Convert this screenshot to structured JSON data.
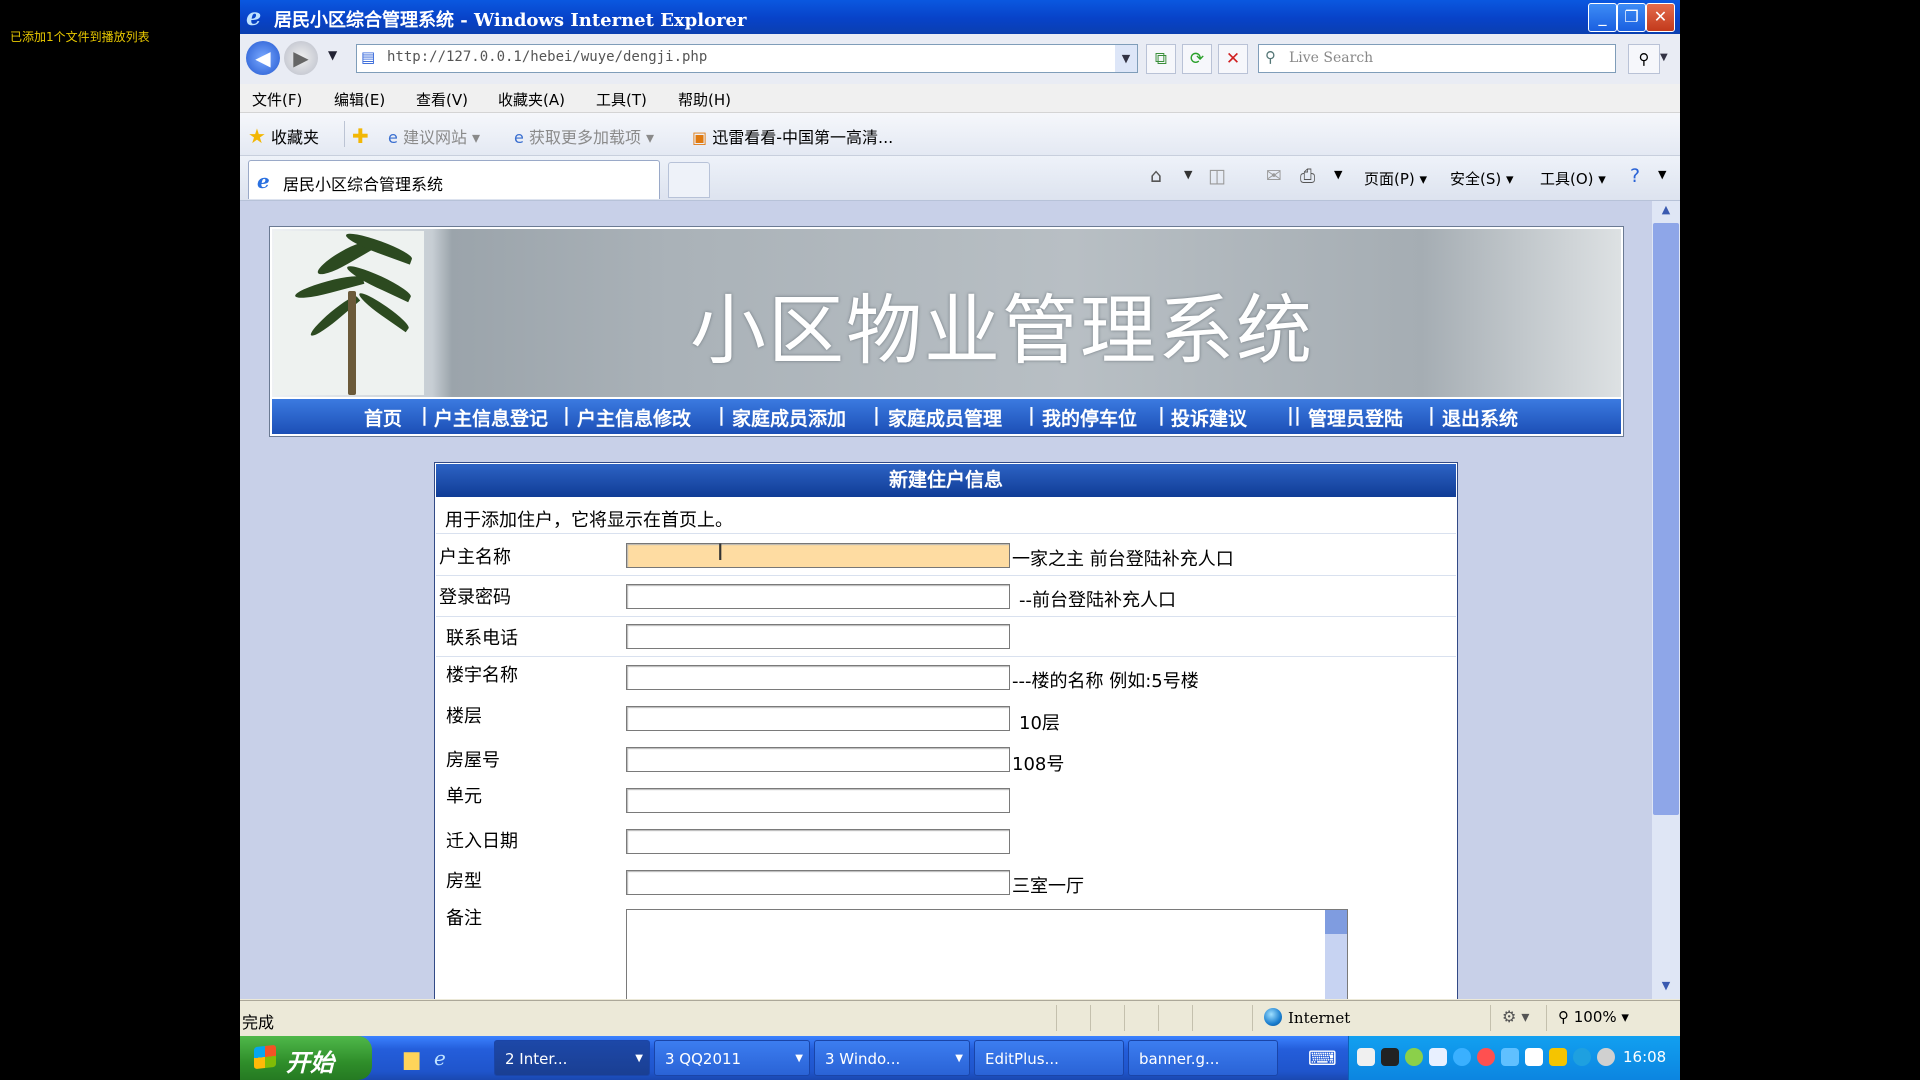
{
  "overlay_note": "已添加1个文件到播放列表",
  "window": {
    "title": "居民小区综合管理系统 - Windows Internet Explorer",
    "minimize": "_",
    "maximize": "❐",
    "close": "✕"
  },
  "address": {
    "url": "http://127.0.0.1/hebei/wuye/dengji.php",
    "search_placeholder": "Live Search"
  },
  "menu": [
    "文件(F)",
    "编辑(E)",
    "查看(V)",
    "收藏夹(A)",
    "工具(T)",
    "帮助(H)"
  ],
  "favorites": {
    "label": "收藏夹",
    "links": [
      "建议网站",
      "获取更多加载项",
      "迅雷看看-中国第一高清..."
    ]
  },
  "tab": {
    "label": "居民小区综合管理系统"
  },
  "commands": {
    "page": "页面(P)",
    "safety": "安全(S)",
    "tools": "工具(O)"
  },
  "banner": {
    "title": "小区物业管理系统"
  },
  "site_nav": [
    "首页",
    "|",
    "户主信息登记",
    "|",
    "户主信息修改",
    "|",
    "家庭成员添加",
    "|",
    "家庭成员管理",
    "|",
    "我的停车位",
    "|",
    "投诉建议",
    "||",
    "管理员登陆",
    "|",
    "退出系统"
  ],
  "form": {
    "heading": "新建住户信息",
    "description": "用于添加住户，它将显示在首页上。",
    "fields": [
      {
        "label": "户主名称",
        "value": "",
        "hint": "一家之主 前台登陆补充人口"
      },
      {
        "label": "登录密码",
        "value": "",
        "hint": "--前台登陆补充人口"
      },
      {
        "label": "联系电话",
        "value": "",
        "hint": ""
      },
      {
        "label": "楼宇名称",
        "value": "",
        "hint": "---楼的名称 例如:5号楼"
      },
      {
        "label": "楼层",
        "value": "",
        "hint": "10层"
      },
      {
        "label": "房屋号",
        "value": "",
        "hint": "108号"
      },
      {
        "label": "单元",
        "value": "",
        "hint": ""
      },
      {
        "label": "迁入日期",
        "value": "",
        "hint": ""
      },
      {
        "label": "房型",
        "value": "",
        "hint": "三室一厅"
      },
      {
        "label": "备注",
        "value": "",
        "hint": ""
      }
    ]
  },
  "status": {
    "text": "完成",
    "zone": "Internet",
    "zoom": "100%"
  },
  "taskbar": {
    "start": "开始",
    "tasks": [
      "2 Inter...",
      "3 QQ2011",
      "3 Windo...",
      "EditPlus...",
      "banner.g..."
    ],
    "clock": "16:08"
  }
}
